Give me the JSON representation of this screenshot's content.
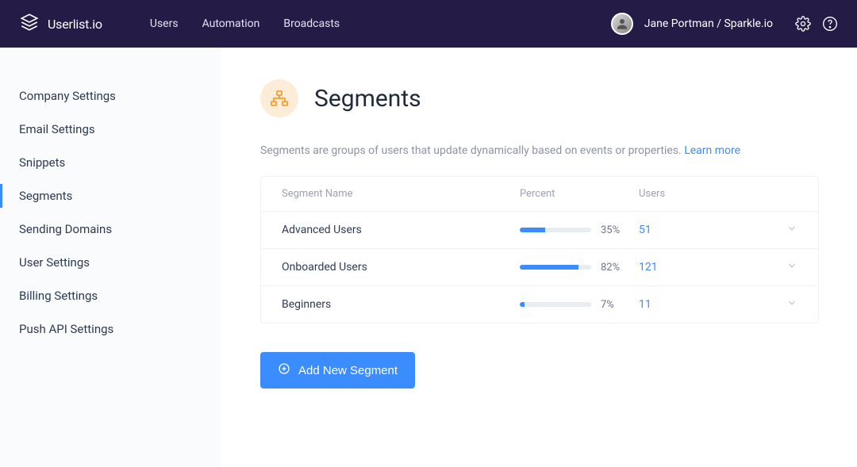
{
  "brand": {
    "name": "Userlist.io"
  },
  "nav": {
    "items": [
      {
        "label": "Users"
      },
      {
        "label": "Automation"
      },
      {
        "label": "Broadcasts"
      }
    ]
  },
  "user": {
    "label": "Jane Portman / Sparkle.io"
  },
  "sidebar": {
    "items": [
      {
        "label": "Company Settings"
      },
      {
        "label": "Email Settings"
      },
      {
        "label": "Snippets"
      },
      {
        "label": "Segments"
      },
      {
        "label": "Sending Domains"
      },
      {
        "label": "User Settings"
      },
      {
        "label": "Billing Settings"
      },
      {
        "label": "Push API Settings"
      }
    ]
  },
  "page": {
    "title": "Segments",
    "description": "Segments are groups of users that update dynamically based on events or properties.",
    "learn_more": "Learn more"
  },
  "table": {
    "headers": {
      "name": "Segment Name",
      "percent": "Percent",
      "users": "Users"
    },
    "rows": [
      {
        "name": "Advanced Users",
        "percent": 35,
        "percent_label": "35%",
        "users": "51"
      },
      {
        "name": "Onboarded Users",
        "percent": 82,
        "percent_label": "82%",
        "users": "121"
      },
      {
        "name": "Beginners",
        "percent": 7,
        "percent_label": "7%",
        "users": "11"
      }
    ]
  },
  "buttons": {
    "add_segment": "Add New Segment"
  },
  "chart_data": {
    "type": "bar",
    "title": "Segments - Percent of Users",
    "categories": [
      "Advanced Users",
      "Onboarded Users",
      "Beginners"
    ],
    "series": [
      {
        "name": "Percent",
        "values": [
          35,
          82,
          7
        ]
      },
      {
        "name": "Users",
        "values": [
          51,
          121,
          11
        ]
      }
    ],
    "xlabel": "Segment",
    "ylabel": "Percent",
    "ylim": [
      0,
      100
    ]
  }
}
